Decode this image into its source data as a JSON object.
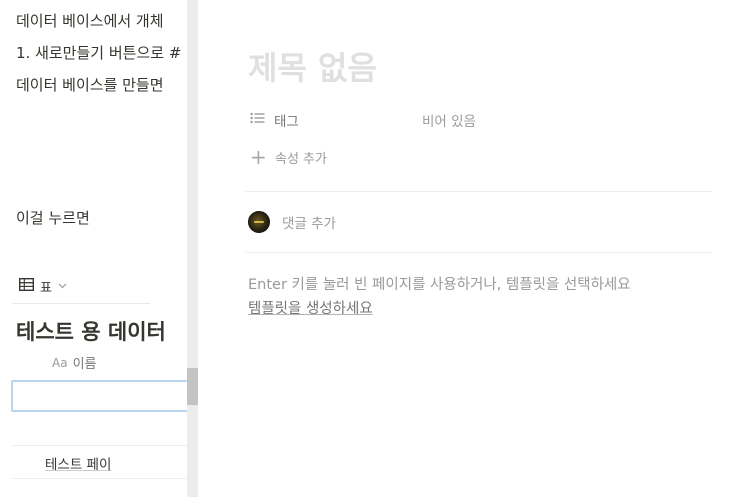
{
  "left_page": {
    "lines": [
      "데이터 베이스에서 개체",
      "1. 새로만들기 버튼으로 #",
      "데이터 베이스를 만들면"
    ],
    "click_hint": "이걸 누르면",
    "view": {
      "icon": "table-icon",
      "label": "표"
    },
    "database_title": "테스트 용 데이터",
    "column_header": {
      "icon_text": "Aa",
      "label": "이름"
    },
    "rows": [
      "테스트 페이"
    ]
  },
  "panel": {
    "title_placeholder": "제목 없음",
    "property": {
      "icon": "list-icon",
      "name": "태그",
      "value_placeholder": "비어 있음"
    },
    "add_property_label": "속성 추가",
    "comment_placeholder": "댓글 추가",
    "hint_text": "Enter 키를 눌러 빈 페이지를 사용하거나, 템플릿을 선택하세요",
    "template_link": "템플릿을 생성하세요"
  }
}
